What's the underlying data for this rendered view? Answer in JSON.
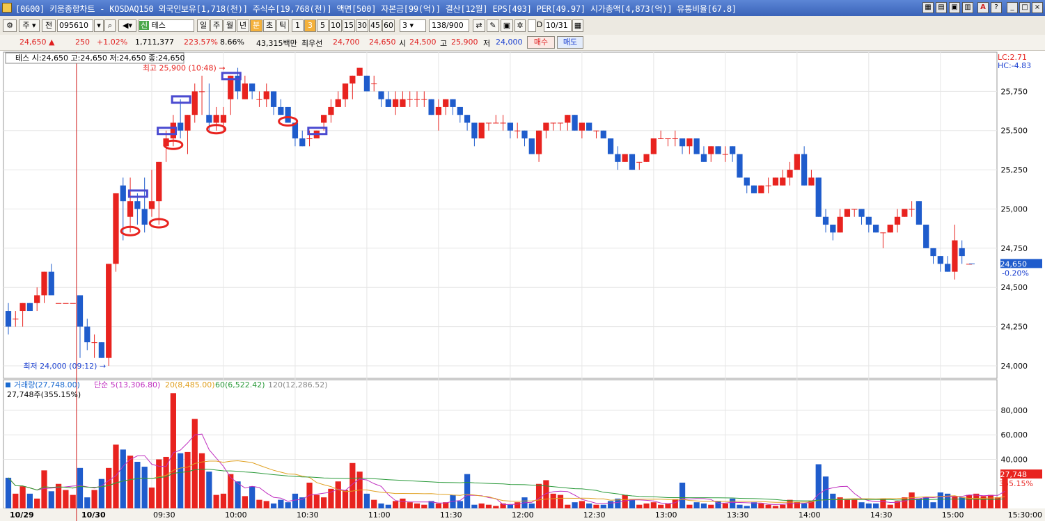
{
  "window": {
    "title": "[0600] 키움종합차트 - KOSDAQ150 외국인보유[1,718(천)] 주식수[19,768(천)] 액면[500] 자본금[99(억)] 결산[12월] EPS[493] PER[49.97] 시가총액[4,873(억)] 유통비율[67.8]"
  },
  "toolbar": {
    "type_select": "주",
    "prev_label": "전",
    "code_value": "095610",
    "name_badge": "신",
    "name_value": "테스",
    "periods": [
      "일",
      "주",
      "월",
      "년",
      "분",
      "초",
      "틱"
    ],
    "selected_period": "분",
    "intervals": [
      "1",
      "3",
      "5",
      "10",
      "15",
      "30",
      "45",
      "60"
    ],
    "selected_interval": "3",
    "custom_interval": "3",
    "count_value": "138",
    "count_total": "/900",
    "d_label": "D",
    "date_value": "10/31"
  },
  "quote": {
    "price": "24,650",
    "change": "250",
    "change_pct": "+1.02%",
    "volume": "1,711,377",
    "volume_ratio": "223.57%",
    "turnover": "8.66%",
    "amount": "43,315백만",
    "best_ask_label": "최우선",
    "best_ask": "24,700",
    "best_bid": "24,650",
    "open_label": "시",
    "open": "24,500",
    "high_label": "고",
    "high": "25,900",
    "low_label": "저",
    "low": "24,000",
    "buy_label": "매수",
    "sell_label": "매도"
  },
  "colors": {
    "up": "#e8231f",
    "down": "#1f5ccc",
    "pattern": "#4a4ad0",
    "vol_ma5": "#c030c0",
    "vol_ma20": "#e0a020",
    "vol_ma60": "#2a9a3a",
    "vol_ma120": "#888888",
    "cursor": "#d02020"
  },
  "chart_data": {
    "type": "candlestick",
    "price_legend": "테스 시:24,650 고:24,650 저:24,650 종:24,650",
    "right_labels": {
      "lc": "LC:2.71",
      "hc": "HC:-4.83"
    },
    "high_annotation": "최고 25,900 (10:48)",
    "low_annotation": "최저 24,000 (09:12)",
    "price_axis": {
      "min": 23920,
      "max": 26000,
      "ticks": [
        "25,750",
        "25,500",
        "25,250",
        "25,000",
        "24,750",
        "24,500",
        "24,250",
        "24,000"
      ]
    },
    "current": {
      "price": "24,650",
      "pct": "-0.20%"
    },
    "volume_legend": [
      {
        "label": "거래량(27,748.00)"
      },
      {
        "label": "단순 5(13,306.80)"
      },
      {
        "label": "20(8,485.00)"
      },
      {
        "label": "60(6,522.42)"
      },
      {
        "label": "120(12,286.52)"
      }
    ],
    "volume_sub": "27,748주(355.15%)",
    "volume_axis": {
      "min": 0,
      "max": 97000,
      "ticks": [
        "80,000",
        "60,000",
        "40,000"
      ]
    },
    "current_volume": {
      "value": "27,748",
      "pct": "355.15%"
    },
    "time_axis": [
      "10/29",
      "10/30",
      "09:30",
      "10:00",
      "10:30",
      "11:00",
      "11:30",
      "12:00",
      "12:30",
      "13:00",
      "13:30",
      "14:00",
      "14:30",
      "15:00",
      "15:30:00"
    ],
    "candles": [
      [
        24350,
        24400,
        24200,
        24250
      ],
      [
        24300,
        24350,
        24250,
        24300
      ],
      [
        24350,
        24400,
        24250,
        24400
      ],
      [
        24400,
        24400,
        24350,
        24350
      ],
      [
        24400,
        24500,
        24350,
        24450
      ],
      [
        24450,
        24600,
        24400,
        24600
      ],
      [
        24600,
        24650,
        24450,
        24450
      ],
      [
        24400,
        24400,
        24400,
        24400
      ],
      [
        24400,
        24400,
        24400,
        24400
      ],
      [
        24400,
        24400,
        24400,
        24400
      ],
      [
        24450,
        24450,
        24050,
        24250
      ],
      [
        24250,
        24300,
        24100,
        24150
      ],
      [
        24150,
        24200,
        24050,
        24150
      ],
      [
        24150,
        24150,
        24050,
        24050
      ],
      [
        24050,
        24650,
        24000,
        24650
      ],
      [
        24650,
        25100,
        24600,
        25100
      ],
      [
        25150,
        25200,
        24800,
        25050
      ],
      [
        24950,
        25200,
        24850,
        25050
      ],
      [
        25050,
        25100,
        24900,
        25000
      ],
      [
        25000,
        25200,
        24850,
        24900
      ],
      [
        25000,
        25250,
        24950,
        25050
      ],
      [
        25050,
        25300,
        24900,
        25300
      ],
      [
        25400,
        25500,
        25300,
        25450
      ],
      [
        25450,
        25600,
        25400,
        25550
      ],
      [
        25550,
        25700,
        25450,
        25500
      ],
      [
        25500,
        25600,
        25350,
        25600
      ],
      [
        25600,
        25800,
        25550,
        25750
      ],
      [
        25750,
        25850,
        25600,
        25750
      ],
      [
        25600,
        25800,
        25500,
        25550
      ],
      [
        25550,
        25650,
        25500,
        25600
      ],
      [
        25550,
        25650,
        25500,
        25600
      ],
      [
        25700,
        25850,
        25600,
        25850
      ],
      [
        25850,
        25900,
        25700,
        25750
      ],
      [
        25700,
        25850,
        25700,
        25800
      ],
      [
        25800,
        25800,
        25700,
        25750
      ],
      [
        25700,
        25750,
        25650,
        25700
      ],
      [
        25700,
        25800,
        25650,
        25750
      ],
      [
        25750,
        25750,
        25600,
        25650
      ],
      [
        25650,
        25700,
        25600,
        25600
      ],
      [
        25650,
        25650,
        25550,
        25550
      ],
      [
        25550,
        25550,
        25400,
        25450
      ],
      [
        25450,
        25500,
        25400,
        25400
      ],
      [
        25450,
        25500,
        25400,
        25450
      ],
      [
        25450,
        25500,
        25450,
        25500
      ],
      [
        25550,
        25600,
        25500,
        25600
      ],
      [
        25600,
        25700,
        25550,
        25650
      ],
      [
        25650,
        25750,
        25650,
        25700
      ],
      [
        25700,
        25800,
        25650,
        25800
      ],
      [
        25800,
        25850,
        25700,
        25850
      ],
      [
        25850,
        25900,
        25850,
        25900
      ],
      [
        25850,
        25850,
        25750,
        25750
      ],
      [
        25800,
        25850,
        25750,
        25800
      ],
      [
        25750,
        25750,
        25650,
        25700
      ],
      [
        25700,
        25750,
        25650,
        25650
      ],
      [
        25650,
        25750,
        25600,
        25700
      ],
      [
        25650,
        25750,
        25650,
        25700
      ],
      [
        25700,
        25750,
        25650,
        25700
      ],
      [
        25700,
        25750,
        25650,
        25700
      ],
      [
        25700,
        25750,
        25650,
        25700
      ],
      [
        25700,
        25700,
        25600,
        25600
      ],
      [
        25600,
        25700,
        25500,
        25650
      ],
      [
        25650,
        25700,
        25600,
        25700
      ],
      [
        25700,
        25700,
        25600,
        25650
      ],
      [
        25650,
        25650,
        25550,
        25600
      ],
      [
        25600,
        25600,
        25500,
        25550
      ],
      [
        25550,
        25550,
        25400,
        25450
      ],
      [
        25450,
        25550,
        25450,
        25550
      ],
      [
        25550,
        25550,
        25500,
        25550
      ],
      [
        25550,
        25600,
        25550,
        25550
      ],
      [
        25550,
        25600,
        25500,
        25550
      ],
      [
        25550,
        25550,
        25450,
        25500
      ],
      [
        25500,
        25550,
        25450,
        25500
      ],
      [
        25500,
        25500,
        25400,
        25450
      ],
      [
        25450,
        25450,
        25350,
        25350
      ],
      [
        25350,
        25500,
        25300,
        25500
      ],
      [
        25500,
        25550,
        25450,
        25550
      ],
      [
        25550,
        25550,
        25500,
        25550
      ],
      [
        25550,
        25550,
        25500,
        25550
      ],
      [
        25550,
        25600,
        25500,
        25600
      ],
      [
        25600,
        25600,
        25500,
        25500
      ],
      [
        25500,
        25550,
        25450,
        25550
      ],
      [
        25550,
        25550,
        25500,
        25500
      ],
      [
        25500,
        25500,
        25450,
        25500
      ],
      [
        25500,
        25500,
        25450,
        25450
      ],
      [
        25450,
        25450,
        25350,
        25350
      ],
      [
        25350,
        25400,
        25250,
        25300
      ],
      [
        25300,
        25350,
        25300,
        25350
      ],
      [
        25350,
        25350,
        25250,
        25250
      ],
      [
        25300,
        25300,
        25250,
        25300
      ],
      [
        25300,
        25350,
        25300,
        25350
      ],
      [
        25350,
        25450,
        25350,
        25450
      ],
      [
        25450,
        25500,
        25450,
        25450
      ],
      [
        25450,
        25450,
        25400,
        25450
      ],
      [
        25450,
        25500,
        25400,
        25450
      ],
      [
        25450,
        25450,
        25350,
        25400
      ],
      [
        25400,
        25450,
        25350,
        25450
      ],
      [
        25450,
        25450,
        25350,
        25350
      ],
      [
        25350,
        25400,
        25300,
        25300
      ],
      [
        25350,
        25400,
        25300,
        25400
      ],
      [
        25400,
        25400,
        25350,
        25350
      ],
      [
        25350,
        25400,
        25300,
        25350
      ],
      [
        25400,
        25400,
        25300,
        25350
      ],
      [
        25350,
        25350,
        25200,
        25200
      ],
      [
        25200,
        25200,
        25100,
        25150
      ],
      [
        25150,
        25150,
        25100,
        25100
      ],
      [
        25100,
        25150,
        25100,
        25150
      ],
      [
        25150,
        25200,
        25100,
        25150
      ],
      [
        25150,
        25200,
        25150,
        25200
      ],
      [
        25150,
        25250,
        25150,
        25200
      ],
      [
        25200,
        25300,
        25150,
        25250
      ],
      [
        25250,
        25350,
        25250,
        25350
      ],
      [
        25350,
        25400,
        25150,
        25150
      ],
      [
        25150,
        25250,
        25150,
        25200
      ],
      [
        25200,
        25200,
        24950,
        24950
      ],
      [
        24950,
        25000,
        24850,
        24900
      ],
      [
        24900,
        24900,
        24800,
        24850
      ],
      [
        24850,
        25000,
        24850,
        24950
      ],
      [
        24950,
        25000,
        24950,
        25000
      ],
      [
        25000,
        25000,
        24950,
        25000
      ],
      [
        25000,
        25000,
        24900,
        24950
      ],
      [
        24950,
        24950,
        24850,
        24900
      ],
      [
        24900,
        24900,
        24850,
        24850
      ],
      [
        24850,
        24850,
        24750,
        24850
      ],
      [
        24850,
        24900,
        24850,
        24900
      ],
      [
        24900,
        25000,
        24850,
        24950
      ],
      [
        24950,
        25000,
        24950,
        25000
      ],
      [
        25000,
        25050,
        24950,
        25000
      ],
      [
        25050,
        25050,
        24900,
        24900
      ],
      [
        24900,
        24900,
        24750,
        24750
      ],
      [
        24750,
        24750,
        24650,
        24700
      ],
      [
        24700,
        24700,
        24600,
        24650
      ],
      [
        24650,
        24700,
        24600,
        24600
      ],
      [
        24600,
        24900,
        24550,
        24800
      ],
      [
        24750,
        24800,
        24650,
        24700
      ],
      [
        24650,
        24650,
        24650,
        24650
      ]
    ],
    "volumes": [
      25000,
      12000,
      18000,
      12000,
      8000,
      31000,
      14000,
      20000,
      15000,
      11000,
      33000,
      9000,
      15000,
      24000,
      33000,
      52000,
      48000,
      43000,
      38000,
      34000,
      17000,
      40000,
      42000,
      94000,
      45000,
      46000,
      73000,
      45000,
      30000,
      11000,
      12000,
      28000,
      22000,
      10000,
      18000,
      7000,
      6000,
      4000,
      7000,
      5000,
      12000,
      9000,
      21000,
      11000,
      9000,
      16000,
      22000,
      15000,
      37000,
      30000,
      12000,
      7000,
      4000,
      3000,
      6000,
      8000,
      5000,
      4000,
      3000,
      6000,
      4000,
      5000,
      11000,
      6000,
      28000,
      3000,
      4000,
      3000,
      2000,
      4000,
      3000,
      5000,
      9000,
      4000,
      20000,
      23000,
      12000,
      11000,
      3000,
      5000,
      6000,
      4000,
      3000,
      3000,
      6000,
      8000,
      11000,
      7000,
      3000,
      4000,
      5000,
      3000,
      4000,
      7000,
      21000,
      3000,
      5000,
      4000,
      3000,
      6000,
      4000,
      8000,
      3000,
      2000,
      5000,
      4000,
      3000,
      2000,
      3000,
      7000,
      5000,
      4000,
      6000,
      36000,
      26000,
      12000,
      9000,
      7000,
      7000,
      5000,
      4000,
      4000,
      8000,
      3000,
      6000,
      9000,
      13000,
      8000,
      9000,
      5000,
      13000,
      12000,
      10000,
      9000,
      11000,
      12000,
      10000,
      11000,
      9000,
      28000
    ]
  }
}
